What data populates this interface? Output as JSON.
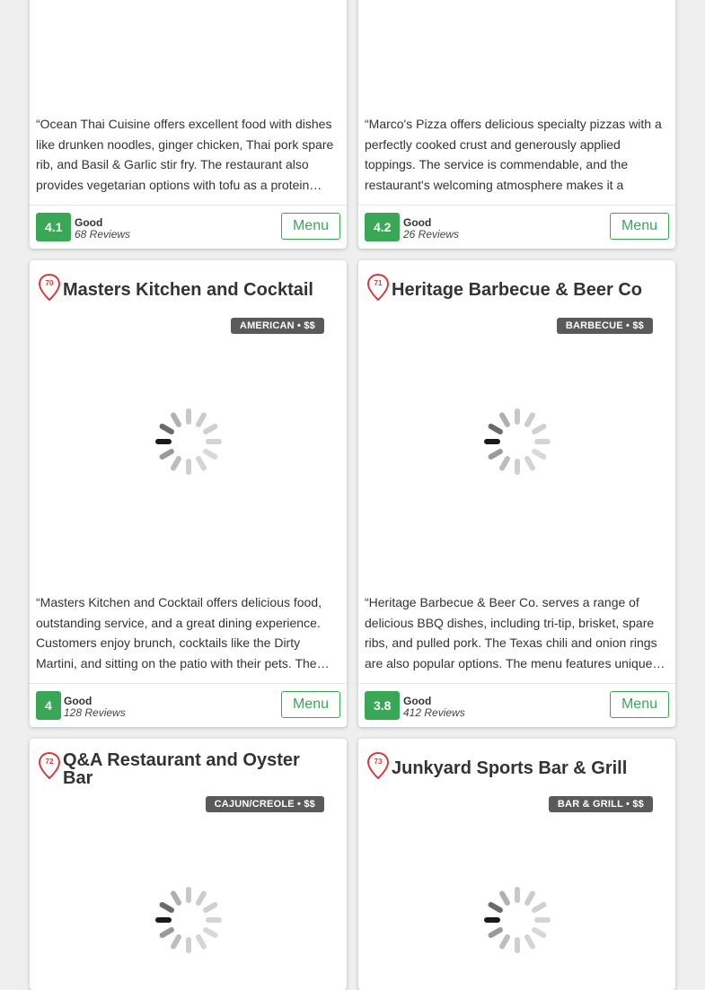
{
  "cards": [
    {
      "desc": "“Ocean Thai Cuisine offers excellent food with dishes like drunken noodles, ginger chicken, Thai pork spare rib, and Basil & Garlic stir fry. The restaurant also provides vegetarian options with tofu as a protein…",
      "score": "4.1",
      "rating": "Good",
      "reviews": "68 Reviews",
      "menu": "Menu"
    },
    {
      "desc": "“Marco's Pizza offers delicious specialty pizzas with a perfectly cooked crust and generously applied toppings. The service is commendable, and the restaurant's welcoming atmosphere makes it a great…",
      "score": "4.2",
      "rating": "Good",
      "reviews": "26 Reviews",
      "menu": "Menu"
    },
    {
      "number": "70",
      "title": "Masters Kitchen and Cocktail",
      "category": "AMERICAN • $$",
      "desc": "“Masters Kitchen and Cocktail offers delicious food, outstanding service, and a great dining experience. Customers enjoy brunch, cocktails like the Dirty Martini, and sitting on the patio with their pets. The…",
      "score": "4",
      "rating": "Good",
      "reviews": "128 Reviews",
      "menu": "Menu"
    },
    {
      "number": "71",
      "title": "Heritage Barbecue & Beer Co",
      "category": "BARBECUE • $$",
      "desc": "“Heritage Barbecue & Beer Co. serves a range of delicious BBQ dishes, including tri-tip, brisket, spare ribs, and pulled pork. The Texas chili and onion rings are also popular options. The menu features unique…",
      "score": "3.8",
      "rating": "Good",
      "reviews": "412 Reviews",
      "menu": "Menu"
    },
    {
      "number": "72",
      "title": "Q&A Restaurant and Oyster Bar",
      "category": "CAJUN/CREOLE • $$"
    },
    {
      "number": "73",
      "title": "Junkyard Sports Bar & Grill",
      "category": "BAR & GRILL • $$"
    }
  ],
  "colors": {
    "accent": "#3aa757",
    "pin": "#d63a3a",
    "badge": "#5a5a5a"
  },
  "icons": {
    "pin": "map-pin-icon",
    "spinner": "loading-spinner-icon"
  }
}
